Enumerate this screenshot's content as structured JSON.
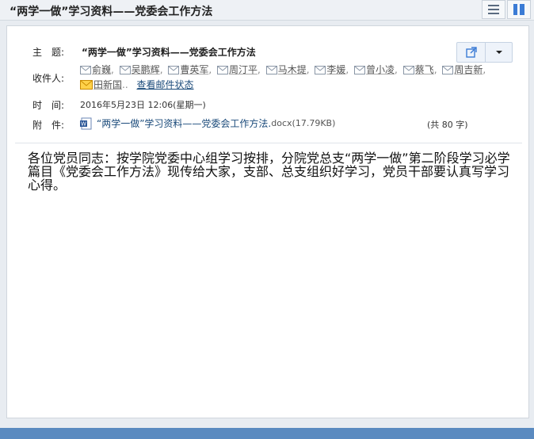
{
  "window": {
    "title": "“两学一做”学习资料——党委会工作方法"
  },
  "header": {
    "subject_label": "主　题:",
    "subject": "“两学一做”学习资料——党委会工作方法",
    "recipients_label": "收件人:",
    "recipients": [
      "俞巍",
      "吴鹏辉",
      "曹英军",
      "周汀平",
      "马木提",
      "李媛",
      "曾小凌",
      "蔡飞",
      "周吉新",
      "田新国"
    ],
    "recipients_more": "..",
    "status_link": "查看邮件状态",
    "time_label": "时　间:",
    "time": "2016年5月23日 12:06(星期一)",
    "attach_label": "附　件:",
    "attach_name": "“两学一做”学习资料——党委会工作方法.",
    "attach_ext": "docx",
    "attach_size": "(17.79KB)",
    "attach_count": "(共 80 字)"
  },
  "body": {
    "text": "各位党员同志：按学院党委中心组学习按排，分院党总支“两学一做”第二阶段学习必学篇目《党委会工作方法》现传给大家，支部、总支组织好学习，党员干部要认真写学习心得。"
  },
  "icons": {
    "list_view": "list-view-icon",
    "split_view": "split-view-icon",
    "open_new": "open-external-icon",
    "dropdown": "caret-down-icon",
    "recipient": "mail-envelope-icon",
    "recipient_unread": "mail-unread-icon",
    "attachment": "word-doc-icon"
  },
  "colors": {
    "link": "#1a4a7a",
    "bottom_bar": "#5a8ac0",
    "unread_envelope": "#e8a000"
  }
}
